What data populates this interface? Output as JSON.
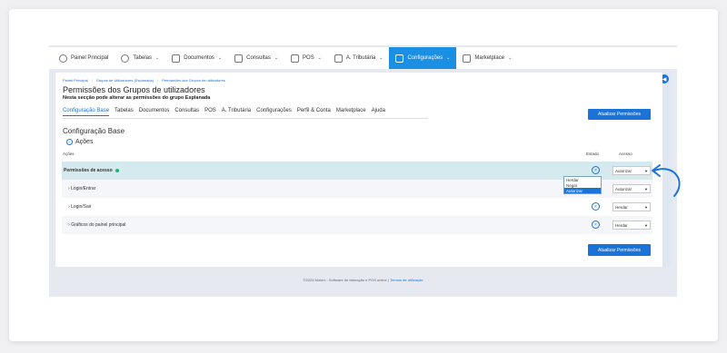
{
  "nav": {
    "items": [
      {
        "label": "Painel Principal",
        "icon": "clock-icon",
        "chevron": ""
      },
      {
        "label": "Tabelas",
        "icon": "users-icon",
        "chevron": "⌄"
      },
      {
        "label": "Documentos",
        "icon": "document-icon",
        "chevron": "⌄"
      },
      {
        "label": "Consultas",
        "icon": "bar-chart-icon",
        "chevron": "⌄"
      },
      {
        "label": "POS",
        "icon": "pos-icon",
        "chevron": "⌄"
      },
      {
        "label": "A. Tributária",
        "icon": "plus-icon",
        "chevron": "⌄"
      },
      {
        "label": "Configurações",
        "icon": "sliders-icon",
        "chevron": "⌄"
      },
      {
        "label": "Marketplace",
        "icon": "grid-icon",
        "chevron": "⌄"
      }
    ],
    "active_index": 6
  },
  "breadcrumb": {
    "items": [
      "Painel Principal",
      "Grupos de Utilizadores (Esplanada)",
      "Permissões dos Grupos de utilizadores"
    ],
    "separator": "/"
  },
  "page": {
    "title": "Permissões dos Grupos de utilizadores",
    "subtitle": "Nesta secção pode alterar as permissões do grupo Esplanada"
  },
  "tabs": [
    {
      "label": "Configuração Base",
      "active": true
    },
    {
      "label": "Tabelas",
      "active": false
    },
    {
      "label": "Documentos",
      "active": false
    },
    {
      "label": "Consultas",
      "active": false
    },
    {
      "label": "POS",
      "active": false
    },
    {
      "label": "A. Tributária",
      "active": false
    },
    {
      "label": "Configurações",
      "active": false
    },
    {
      "label": "Perfil & Conta",
      "active": false
    },
    {
      "label": "Marketplace",
      "active": false
    },
    {
      "label": "Ajuda",
      "active": false
    }
  ],
  "buttons": {
    "update_top": "Atualizar Permissões",
    "update_bottom": "Atualizar Permissões"
  },
  "section": {
    "title": "Configuração Base",
    "group_label": "Ações",
    "group_icon": "minus-icon"
  },
  "columns": {
    "actions": "Ações",
    "state": "Estado",
    "access": "Acesso"
  },
  "rows": [
    {
      "label": "Permissões de acesso",
      "value": "Autorizar",
      "kind": "header"
    },
    {
      "label": "Login/Entrar",
      "value": "Autorizar",
      "kind": "sub"
    },
    {
      "label": "Login/Sair",
      "value": "Herdar",
      "kind": "sub"
    },
    {
      "label": "Gráficos do painel principal",
      "value": "Herdar",
      "kind": "sub"
    }
  ],
  "dropdown": {
    "options": [
      "Herdar",
      "Negar",
      "Autorizar"
    ],
    "selected": "Autorizar"
  },
  "footer": {
    "text": "©2024 Moloni - Software de faturação e POS online",
    "separator": "|",
    "link": "Termos de utilização"
  },
  "colors": {
    "accent": "#1a73d9",
    "active_nav": "#1a8fe3",
    "header_row": "#d5eaee"
  }
}
